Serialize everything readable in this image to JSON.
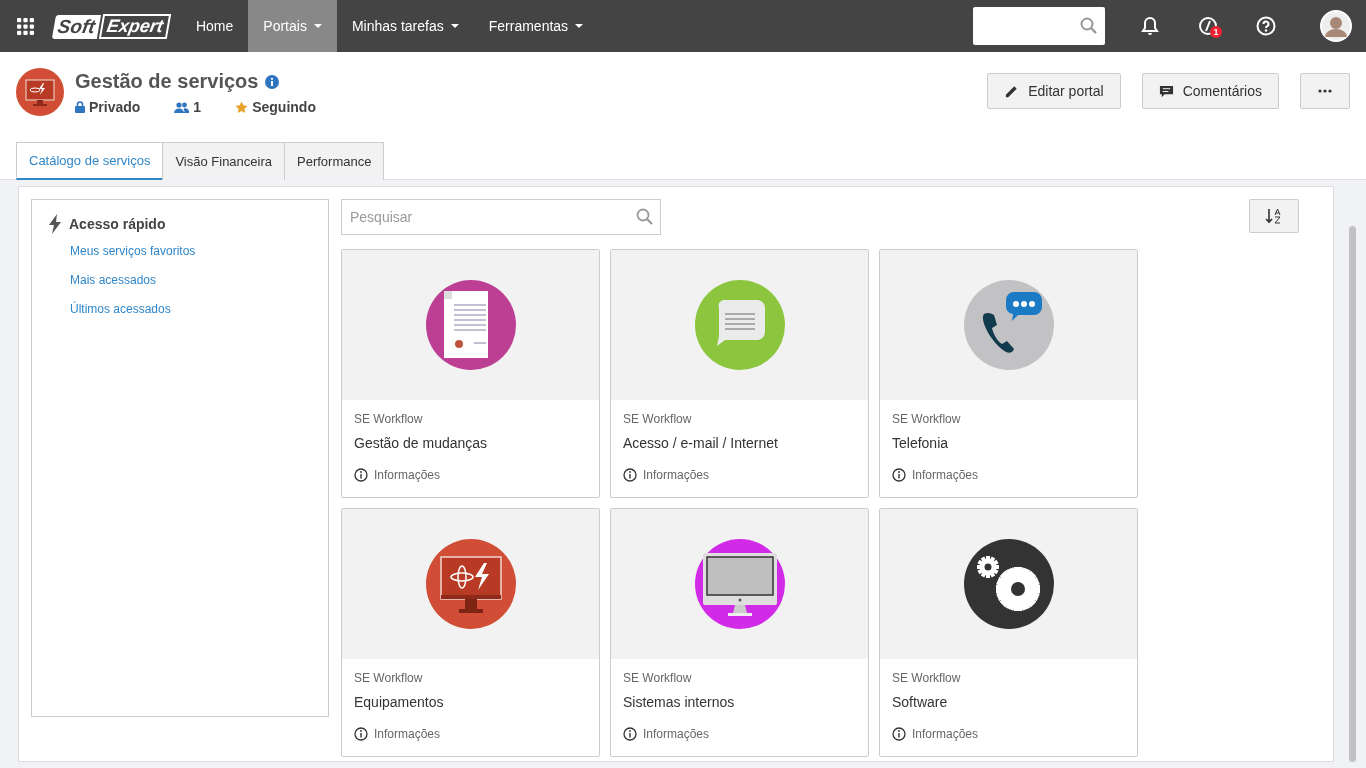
{
  "topbar": {
    "logo": [
      "Soft",
      "Expert"
    ],
    "nav": [
      {
        "label": "Home",
        "selected": false,
        "dropdown": false
      },
      {
        "label": "Portais",
        "selected": true,
        "dropdown": true
      },
      {
        "label": "Minhas tarefas",
        "selected": false,
        "dropdown": true
      },
      {
        "label": "Ferramentas",
        "selected": false,
        "dropdown": true
      }
    ],
    "notification_badge": "1"
  },
  "portal": {
    "title": "Gestão de serviços",
    "privacy": "Privado",
    "members": "1",
    "following": "Seguindo"
  },
  "actions": [
    {
      "kind": "edit",
      "label": "Editar portal"
    },
    {
      "kind": "comments",
      "label": "Comentários"
    },
    {
      "kind": "more"
    }
  ],
  "tabs": [
    {
      "label": "Catálogo de serviços",
      "selected": true
    },
    {
      "label": "Visão Financeira",
      "selected": false
    },
    {
      "label": "Performance",
      "selected": false
    }
  ],
  "quick_access": {
    "title": "Acesso rápido",
    "links": [
      "Meus serviços favoritos",
      "Mais acessados",
      "Últimos acessados"
    ]
  },
  "search": {
    "placeholder": "Pesquisar"
  },
  "cards": [
    {
      "kind": "document",
      "category": "SE Workflow",
      "title": "Gestão de mudanças",
      "info": "Informações"
    },
    {
      "kind": "chat",
      "category": "SE Workflow",
      "title": "Acesso / e-mail / Internet",
      "info": "Informações"
    },
    {
      "kind": "phone",
      "category": "SE Workflow",
      "title": "Telefonia",
      "info": "Informações"
    },
    {
      "kind": "equipment",
      "category": "SE Workflow",
      "title": "Equipamentos",
      "info": "Informações"
    },
    {
      "kind": "computer",
      "category": "SE Workflow",
      "title": "Sistemas internos",
      "info": "Informações"
    },
    {
      "kind": "gears",
      "category": "SE Workflow",
      "title": "Software",
      "info": "Informações"
    }
  ]
}
